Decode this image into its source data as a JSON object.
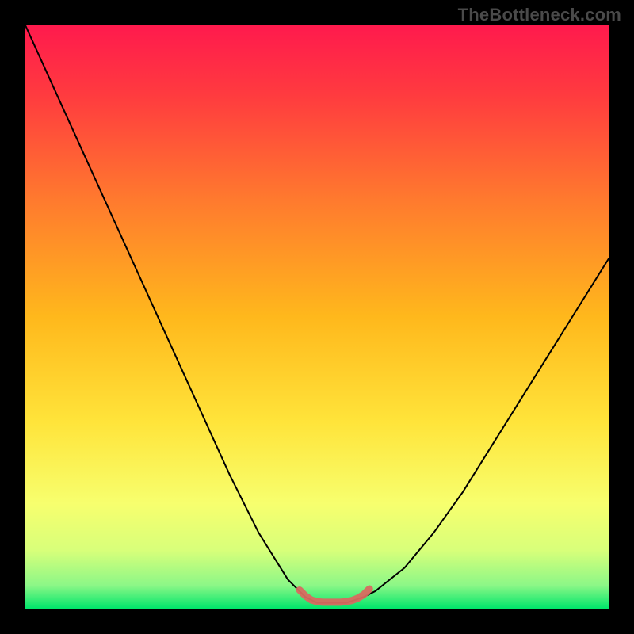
{
  "watermark": "TheBottleneck.com",
  "chart_data": {
    "type": "line",
    "title": "",
    "xlabel": "",
    "ylabel": "",
    "xlim": [
      0,
      100
    ],
    "ylim": [
      0,
      100
    ],
    "grid": false,
    "legend": false,
    "background_gradient_top": "#ff1a4d",
    "background_gradient_mid": "#ffd600",
    "background_gradient_bottom": "#00e66b",
    "series": [
      {
        "name": "bottleneck-curve",
        "color": "#000000",
        "x": [
          0,
          5,
          10,
          15,
          20,
          25,
          30,
          35,
          40,
          45,
          48,
          50,
          52,
          55,
          58,
          60,
          65,
          70,
          75,
          80,
          85,
          90,
          95,
          100
        ],
        "y": [
          100,
          89,
          78,
          67,
          56,
          45,
          34,
          23,
          13,
          5,
          2,
          1,
          1,
          1,
          2,
          3,
          7,
          13,
          20,
          28,
          36,
          44,
          52,
          60
        ]
      },
      {
        "name": "optimal-zone-marker",
        "color": "#d86a60",
        "x": [
          47,
          48,
          49,
          50,
          51,
          52,
          53,
          54,
          55,
          56,
          57,
          58,
          59
        ],
        "y": [
          3.2,
          2.2,
          1.5,
          1.2,
          1.1,
          1.1,
          1.1,
          1.1,
          1.2,
          1.4,
          1.8,
          2.4,
          3.4
        ]
      }
    ],
    "annotations": []
  }
}
